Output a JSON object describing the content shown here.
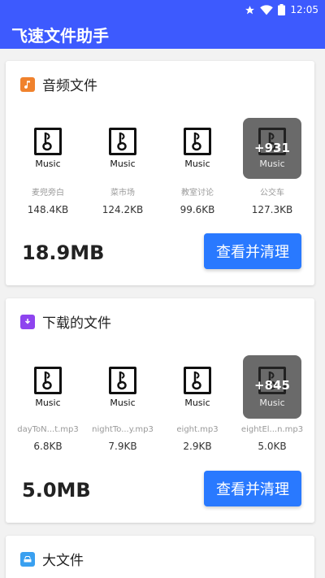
{
  "status_bar": {
    "time": "12:05",
    "icons": [
      "star-icon",
      "wifi-icon",
      "battery-icon"
    ]
  },
  "app_bar": {
    "title": "飞速文件助手"
  },
  "sections": [
    {
      "title": "音频文件",
      "icon": "music-note-icon",
      "icon_color": "#f0822d",
      "files": [
        {
          "type_label": "Music",
          "name": "麦兜旁白",
          "size": "148.4KB"
        },
        {
          "type_label": "Music",
          "name": "菜市场",
          "size": "124.2KB"
        },
        {
          "type_label": "Music",
          "name": "教室讨论",
          "size": "99.6KB"
        },
        {
          "type_label": "Music",
          "name": "公交车",
          "size": "127.3KB",
          "more": "+931"
        }
      ],
      "total": "18.9MB",
      "button_label": "查看并清理"
    },
    {
      "title": "下载的文件",
      "icon": "download-folder-icon",
      "icon_color": "#8e44ef",
      "files": [
        {
          "type_label": "Music",
          "name": "dayToN...t.mp3",
          "size": "6.8KB"
        },
        {
          "type_label": "Music",
          "name": "nightTo...y.mp3",
          "size": "7.9KB"
        },
        {
          "type_label": "Music",
          "name": "eight.mp3",
          "size": "2.9KB"
        },
        {
          "type_label": "Music",
          "name": "eightEl...n.mp3",
          "size": "5.0KB",
          "more": "+845"
        }
      ],
      "total": "5.0MB",
      "button_label": "查看并清理"
    },
    {
      "title": "大文件",
      "icon": "drive-icon",
      "icon_color": "#3aa0f0"
    }
  ],
  "colors": {
    "primary": "#3d5afe",
    "button": "#2979ff"
  }
}
